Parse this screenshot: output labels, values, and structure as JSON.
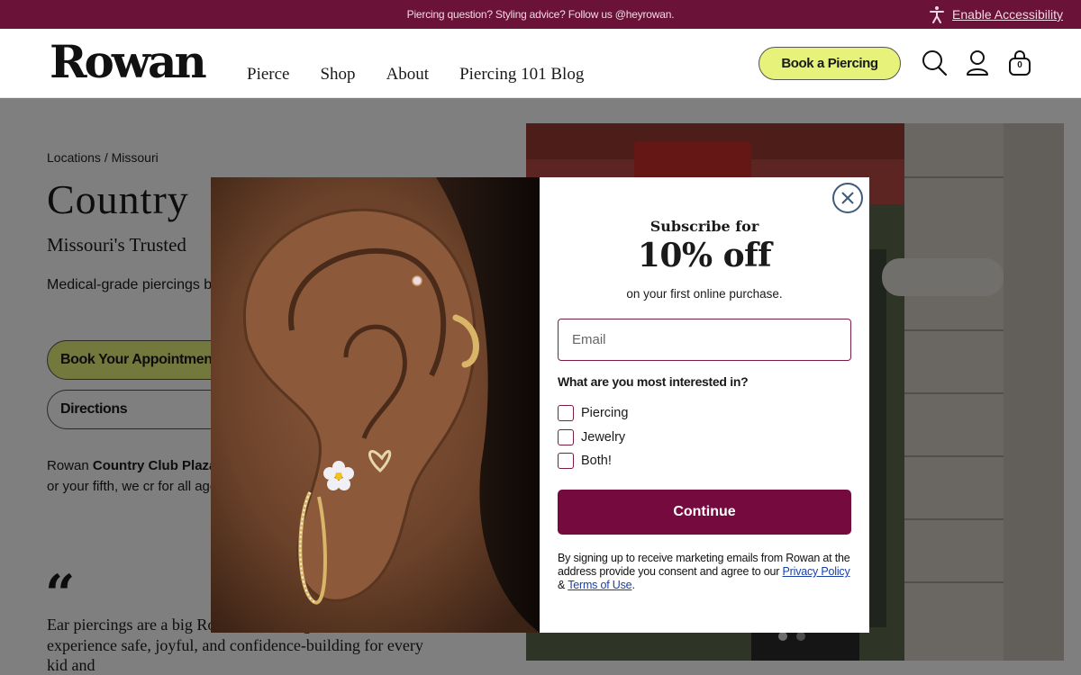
{
  "announcement": {
    "message": "Piercing question? Styling advice? Follow us @heyrowan.",
    "accessibility_label": "Enable Accessibility"
  },
  "header": {
    "logo": "Rowan",
    "nav": [
      "Pierce",
      "Shop",
      "About",
      "Piercing 101 Blog"
    ],
    "book_button": "Book a Piercing",
    "cart_count": "0",
    "icons": [
      "search-icon",
      "account-icon",
      "cart-icon"
    ]
  },
  "page": {
    "breadcrumb": "Locations / Missouri",
    "title": "Country",
    "subtitle": "Missouri's Trusted",
    "lead": "Medical-grade piercings b welcoming environment.",
    "appointment_button": "Book Your Appointment",
    "directions_button": "Directions",
    "about_prefix": "Rowan",
    "about_bold": "Country Club Plaza",
    "about_rest": "piercings by licensed nurse piercing or your fifth, we cr for all ages.",
    "quote_mark": "“",
    "quote": "Ear piercings are a big Rowan Nurse, I get to make that experience safe, joyful, and confidence-building for every kid and"
  },
  "popup": {
    "subscribe_for": "Subscribe for",
    "discount": "10% off",
    "first_purchase": "on your first online purchase.",
    "email_placeholder": "Email",
    "question": "What are you most interested in?",
    "options": [
      "Piercing",
      "Jewelry",
      "Both!"
    ],
    "continue_button": "Continue",
    "legal_text": "By signing up to receive marketing emails from Rowan at the address provide you consent and agree to our",
    "privacy_link": "Privacy Policy",
    "ampersand": "&",
    "terms_link": "Terms of Use",
    "period": "."
  },
  "colors": {
    "brand_plum": "#740a3d",
    "announcement_bg": "#6b1238",
    "accent_lime": "#e6f27a",
    "link_blue": "#1a3fa6"
  }
}
